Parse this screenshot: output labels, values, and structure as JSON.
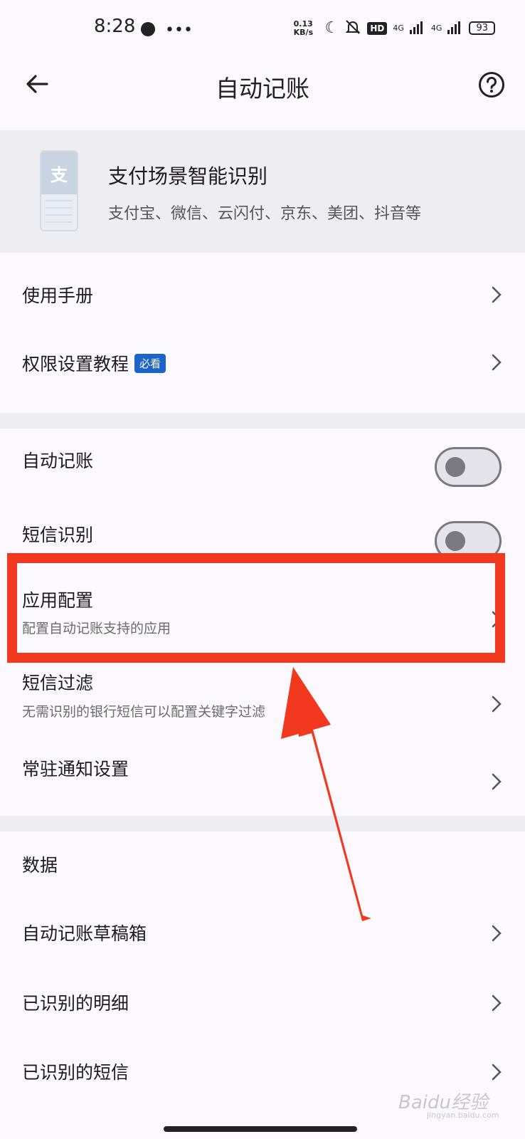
{
  "status": {
    "time": "8:28",
    "speed": "0.13 KB/s",
    "network1": "4G",
    "network2": "4G",
    "battery": "93",
    "hd": "HD"
  },
  "appbar": {
    "title": "自动记账",
    "back_icon": "arrow-left-icon",
    "help_icon": "help-circle-icon"
  },
  "header": {
    "icon_glyph": "支",
    "title": "支付场景智能识别",
    "subtitle": "支付宝、微信、云闪付、京东、美团、抖音等"
  },
  "group1": [
    {
      "label": "使用手册"
    },
    {
      "label": "权限设置教程",
      "badge": "必看"
    }
  ],
  "group2": {
    "auto_record": "自动记账",
    "sms_recognition": "短信识别",
    "app_config": {
      "label": "应用配置",
      "sub": "配置自动记账支持的应用"
    },
    "sms_filter": {
      "label": "短信过滤",
      "sub": "无需识别的银行短信可以配置关键字过滤"
    },
    "notification": "常驻通知设置"
  },
  "data_section": {
    "heading": "数据",
    "items": [
      "自动记账草稿箱",
      "已识别的明细",
      "已识别的短信"
    ]
  },
  "toggles": {
    "auto_record_on": false,
    "sms_recognition_on": false
  },
  "annotation": {
    "color": "#f2391f"
  },
  "watermark": {
    "brand": "Baidu经验",
    "domain": "jingyan.baidu.com"
  }
}
